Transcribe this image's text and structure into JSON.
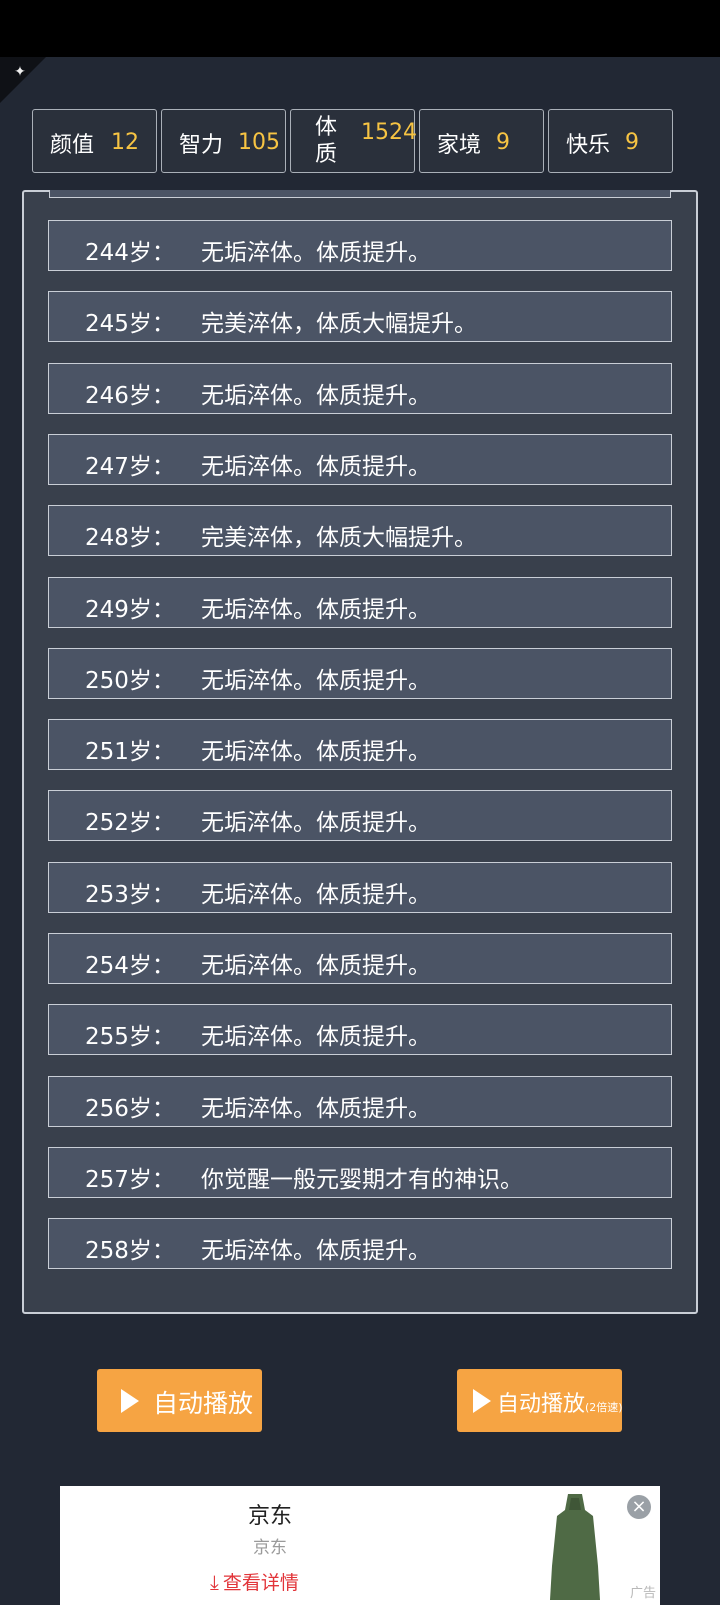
{
  "stats": [
    {
      "label": "颜值",
      "value": "12"
    },
    {
      "label": "智力",
      "value": "105"
    },
    {
      "label": "体\n质",
      "value": "1524"
    },
    {
      "label": "家境",
      "value": "9"
    },
    {
      "label": "快乐",
      "value": "9"
    }
  ],
  "log": [
    {
      "age": "244岁：",
      "text": "无垢淬体。体质提升。"
    },
    {
      "age": "245岁：",
      "text": "完美淬体，体质大幅提升。"
    },
    {
      "age": "246岁：",
      "text": "无垢淬体。体质提升。"
    },
    {
      "age": "247岁：",
      "text": "无垢淬体。体质提升。"
    },
    {
      "age": "248岁：",
      "text": "完美淬体，体质大幅提升。"
    },
    {
      "age": "249岁：",
      "text": "无垢淬体。体质提升。"
    },
    {
      "age": "250岁：",
      "text": "无垢淬体。体质提升。"
    },
    {
      "age": "251岁：",
      "text": "无垢淬体。体质提升。"
    },
    {
      "age": "252岁：",
      "text": "无垢淬体。体质提升。"
    },
    {
      "age": "253岁：",
      "text": "无垢淬体。体质提升。"
    },
    {
      "age": "254岁：",
      "text": "无垢淬体。体质提升。"
    },
    {
      "age": "255岁：",
      "text": "无垢淬体。体质提升。"
    },
    {
      "age": "256岁：",
      "text": "无垢淬体。体质提升。"
    },
    {
      "age": "257岁：",
      "text": "你觉醒一般元婴期才有的神识。"
    },
    {
      "age": "258岁：",
      "text": "无垢淬体。体质提升。"
    }
  ],
  "buttons": {
    "auto_play": "自动播放",
    "auto_play_fast": "自动播放",
    "auto_play_fast_suffix": "(2倍速)"
  },
  "ad": {
    "title": "京东",
    "subtitle": "京东",
    "cta": "查看详情",
    "tag": "广告"
  },
  "colors": {
    "background": "#222834",
    "stat_value": "#f7c443",
    "button": "#f6a443",
    "row": "#4b5465"
  }
}
